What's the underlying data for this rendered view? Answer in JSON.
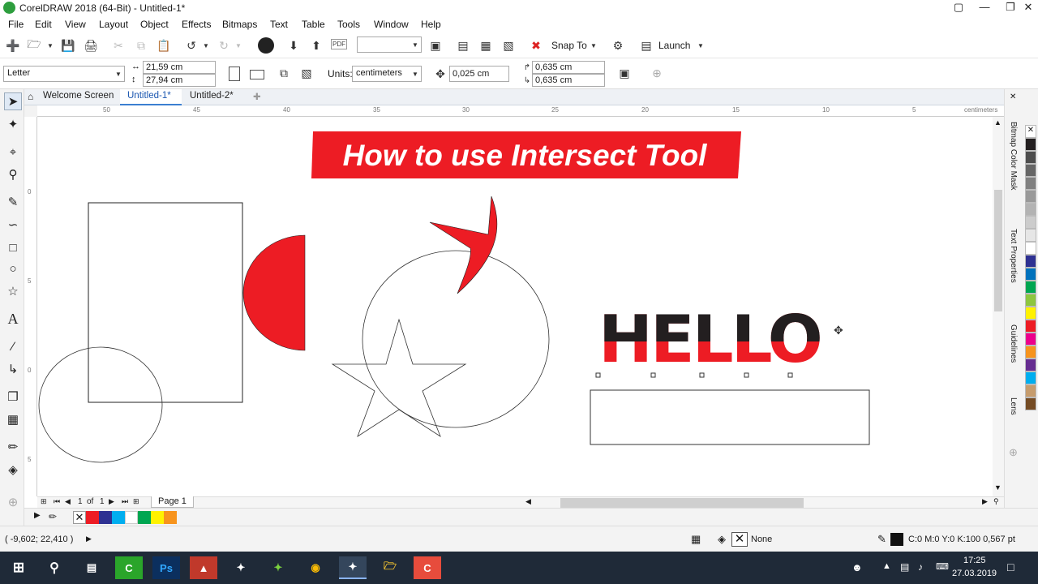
{
  "window": {
    "title": "CorelDRAW 2018 (64-Bit) - Untitled-1*"
  },
  "menu": [
    "File",
    "Edit",
    "View",
    "Layout",
    "Object",
    "Effects",
    "Bitmaps",
    "Text",
    "Table",
    "Tools",
    "Window",
    "Help"
  ],
  "toolbar": {
    "snap_label": "Snap To",
    "launch_label": "Launch",
    "pdf_label": "PDF"
  },
  "propbar": {
    "page_size": "Letter",
    "width": "21,59 cm",
    "height": "27,94 cm",
    "units_label": "Units:",
    "units_value": "centimeters",
    "nudge": "0,025 cm",
    "dup_x": "0,635 cm",
    "dup_y": "0,635 cm"
  },
  "tabs": [
    "Welcome Screen",
    "Untitled-1*",
    "Untitled-2*"
  ],
  "ruler": {
    "unit": "centimeters",
    "h_ticks": [
      "50",
      "45",
      "40",
      "35",
      "30",
      "25",
      "20",
      "15",
      "10",
      "5"
    ],
    "v_ticks": [
      "0",
      "5",
      "0",
      "5"
    ]
  },
  "canvas": {
    "banner_text": "How to use Intersect Tool",
    "hello_text": "HELLO",
    "accent_red": "#ed1c24",
    "dark": "#231f20"
  },
  "dockers": [
    "Bitmap Color Mask",
    "Text Properties",
    "Guidelines",
    "Lens"
  ],
  "pager": {
    "current": "1",
    "of_label": "of",
    "total": "1",
    "page_tab": "Page 1"
  },
  "status": {
    "coords": "( -9,602; 22,410 )",
    "fill_label": "None",
    "outline_label": "C:0 M:0 Y:0 K:100  0,567 pt"
  },
  "taskbar": {
    "time": "17:25",
    "date": "27.03.2019"
  },
  "palette_colors": [
    "#ffffff",
    "#231f20",
    "#4d4d4d",
    "#666666",
    "#808080",
    "#999999",
    "#b3b3b3",
    "#cccccc",
    "#e6e6e6",
    "#ffffff",
    "#2e3192",
    "#0072bc",
    "#00a651",
    "#8dc63f",
    "#fff200",
    "#ed1c24",
    "#ec008c",
    "#f7941d",
    "#662d91",
    "#00aeef",
    "#c69c6d",
    "#754c24"
  ],
  "doc_palette_colors": [
    "#ed1c24",
    "#2e3192",
    "#00aeef",
    "#ffffff",
    "#00a651",
    "#fff200",
    "#f7941d"
  ]
}
